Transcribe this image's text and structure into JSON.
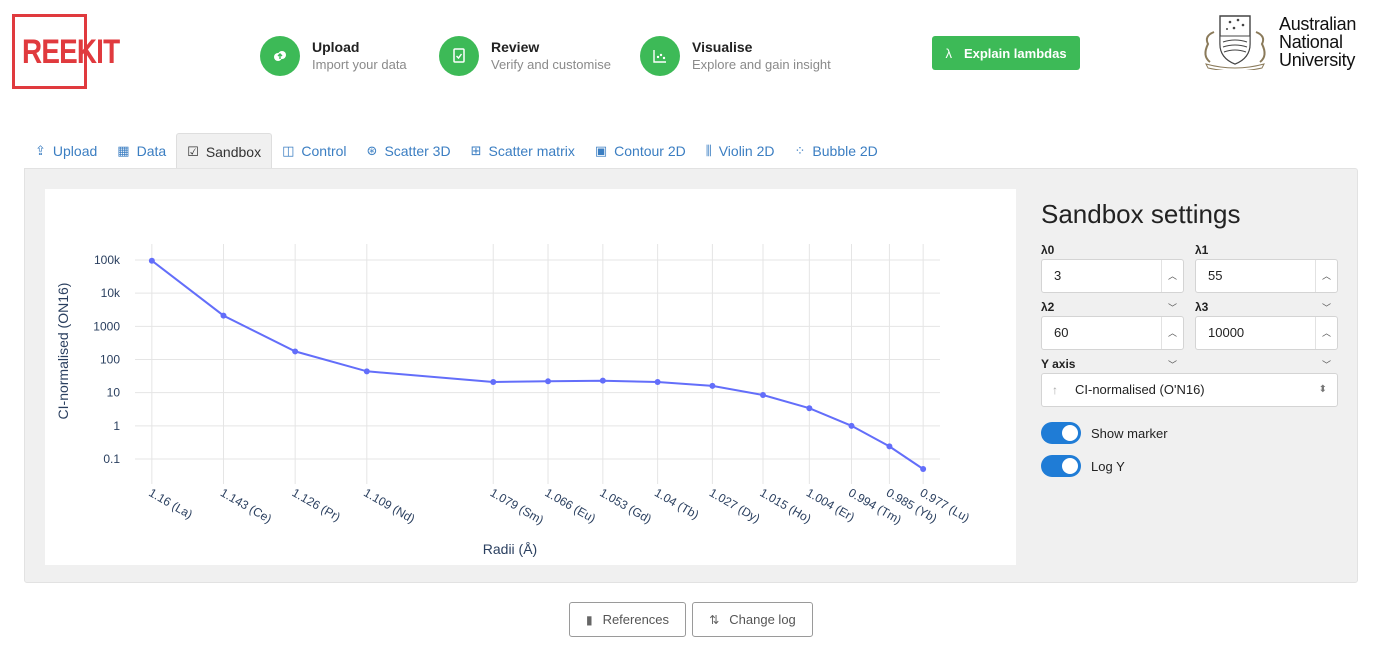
{
  "brand": {
    "logo_text": "REEKIT"
  },
  "steps": [
    {
      "title": "Upload",
      "subtitle": "Import your data",
      "icon": "cloud-upload-icon"
    },
    {
      "title": "Review",
      "subtitle": "Verify and customise",
      "icon": "document-check-icon"
    },
    {
      "title": "Visualise",
      "subtitle": "Explore and gain insight",
      "icon": "chart-icon"
    }
  ],
  "explain_button": {
    "icon": "λ",
    "label": "Explain lambdas"
  },
  "university": {
    "line1": "Australian",
    "line2": "National",
    "line3": "University"
  },
  "tabs": [
    {
      "label": "Upload",
      "icon": "⇪",
      "active": false
    },
    {
      "label": "Data",
      "icon": "▦",
      "active": false
    },
    {
      "label": "Sandbox",
      "icon": "☑",
      "active": true
    },
    {
      "label": "Control",
      "icon": "◫",
      "active": false
    },
    {
      "label": "Scatter 3D",
      "icon": "⊛",
      "active": false
    },
    {
      "label": "Scatter matrix",
      "icon": "⊞",
      "active": false
    },
    {
      "label": "Contour 2D",
      "icon": "▣",
      "active": false
    },
    {
      "label": "Violin 2D",
      "icon": "⫼",
      "active": false
    },
    {
      "label": "Bubble 2D",
      "icon": "⁘",
      "active": false
    }
  ],
  "settings": {
    "title": "Sandbox settings",
    "lambda0": {
      "label": "λ0",
      "value": "3"
    },
    "lambda1": {
      "label": "λ1",
      "value": "55"
    },
    "lambda2": {
      "label": "λ2",
      "value": "60"
    },
    "lambda3": {
      "label": "λ3",
      "value": "10000"
    },
    "yaxis": {
      "label": "Y axis",
      "value": "CI-normalised (O'N16)"
    },
    "show_marker": {
      "label": "Show marker",
      "on": true
    },
    "log_y": {
      "label": "Log Y",
      "on": true
    }
  },
  "chart_data": {
    "type": "line",
    "xlabel": "Radii (Å)",
    "ylabel": "CI-normalised (ON16)",
    "yscale": "log",
    "ylim": [
      0.05,
      100000
    ],
    "yticks": [
      "100k",
      "10k",
      "1000",
      "100",
      "10",
      "1",
      "0.1"
    ],
    "ytick_values": [
      100000,
      10000,
      1000,
      100,
      10,
      1,
      0.1
    ],
    "x": [
      1.16,
      1.143,
      1.126,
      1.109,
      1.079,
      1.066,
      1.053,
      1.04,
      1.027,
      1.015,
      1.004,
      0.994,
      0.985,
      0.977
    ],
    "xticklabels": [
      "1.16 (La)",
      "1.143 (Ce)",
      "1.126 (Pr)",
      "1.109 (Nd)",
      "1.079 (Sm)",
      "1.066 (Eu)",
      "1.053 (Gd)",
      "1.04 (Tb)",
      "1.027 (Dy)",
      "1.015 (Ho)",
      "1.004 (Er)",
      "0.994 (Tm)",
      "0.985 (Yb)",
      "0.977 (Lu)"
    ],
    "values": [
      95000,
      2100,
      175,
      44,
      21,
      22,
      23,
      21,
      16,
      8.5,
      3.4,
      1.0,
      0.24,
      0.05
    ],
    "grid": true,
    "line_color": "#636efa"
  },
  "footer": {
    "references": {
      "label": "References",
      "icon": "book-icon"
    },
    "changelog": {
      "label": "Change log",
      "icon": "git-compare-icon"
    }
  }
}
